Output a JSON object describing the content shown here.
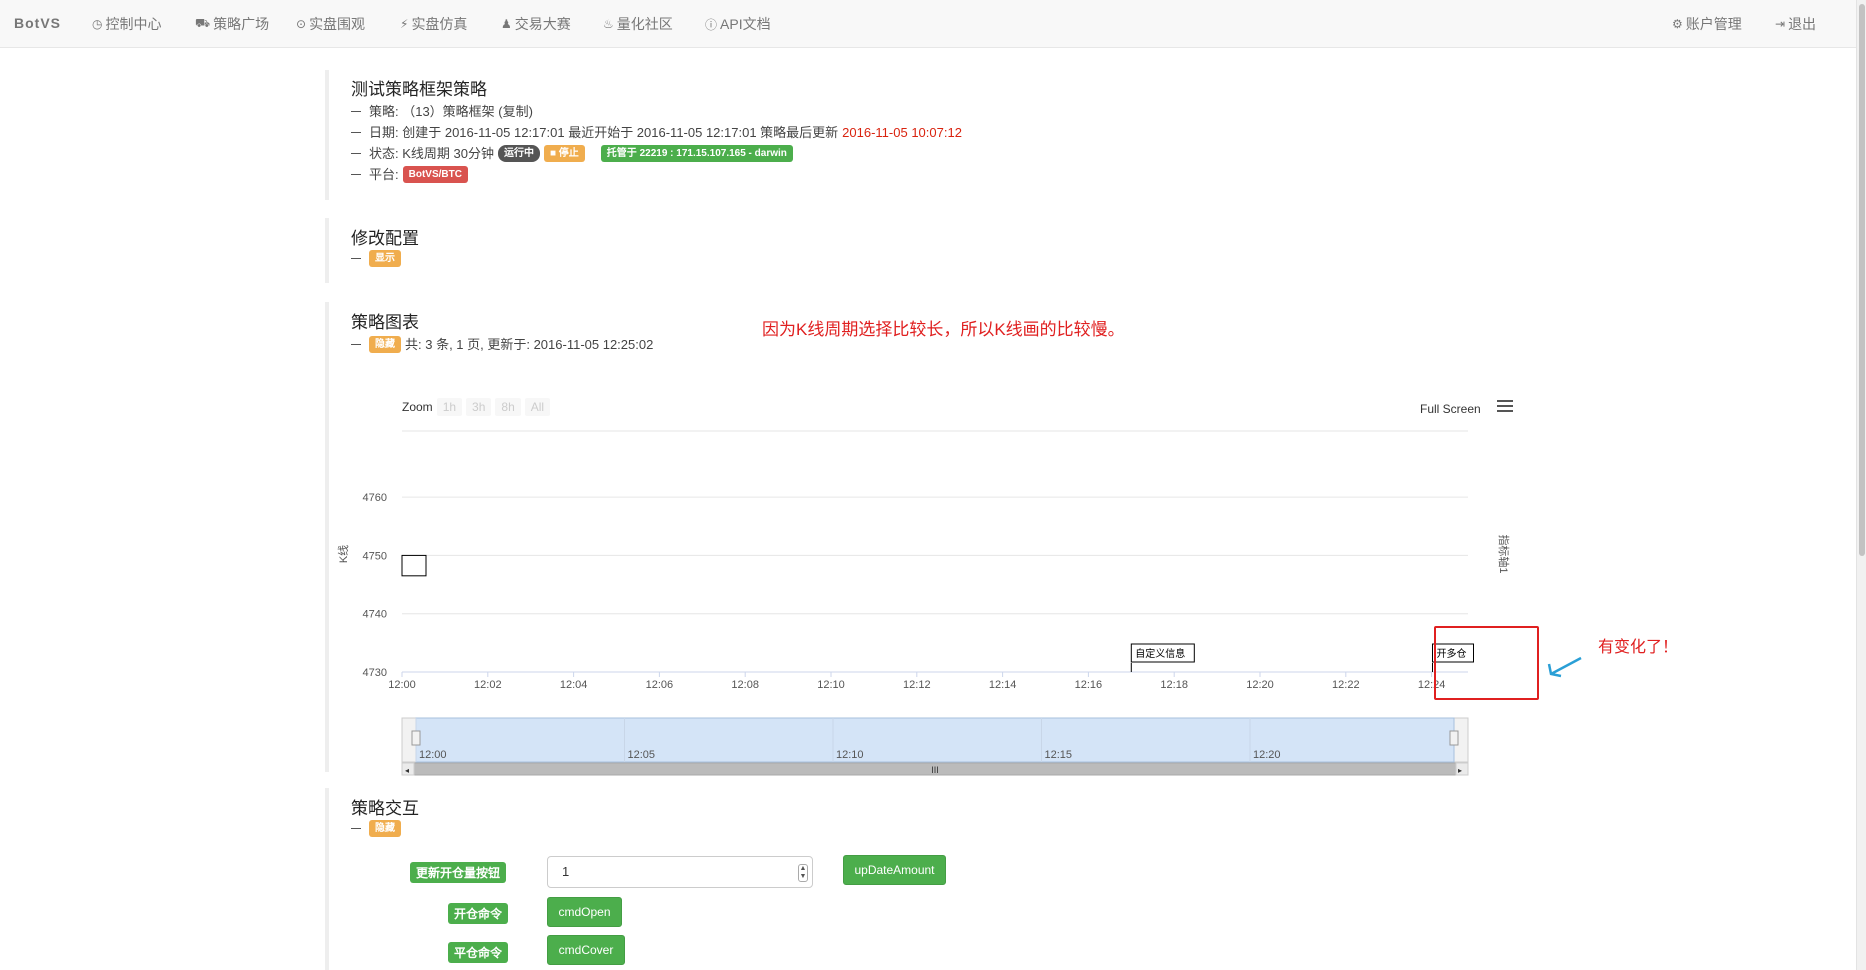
{
  "nav": {
    "brand": "BotVS",
    "items": [
      {
        "label": "控制中心",
        "icon": "clock-icon"
      },
      {
        "label": "策略广场",
        "icon": "cart-icon"
      },
      {
        "label": "实盘围观",
        "icon": "play-circle-icon"
      },
      {
        "label": "实盘仿真",
        "icon": "bolt-icon"
      },
      {
        "label": "交易大赛",
        "icon": "user-icon"
      },
      {
        "label": "量化社区",
        "icon": "fire-icon"
      },
      {
        "label": "API文档",
        "icon": "info-icon"
      }
    ],
    "account": "账户管理",
    "logout": "退出"
  },
  "strategy": {
    "title": "测试策略框架策略",
    "line1": "策略: （13）策略框架 (复制)",
    "date_prefix": "日期: 创建于 2016-11-05 12:17:01 最近开始于 2016-11-05 12:17:01 策略最后更新",
    "date_updated": "2016-11-05 10:07:12",
    "status_prefix": "状态: K线周期 30分钟",
    "status_running": "运行中",
    "status_stop": "停止",
    "host": "托管于 22219 : 171.15.107.165 - darwin",
    "platform_prefix": "平台:",
    "platform": "BotVS/BTC"
  },
  "config": {
    "title": "修改配置",
    "toggle": "显示"
  },
  "chart_section": {
    "title": "策略图表",
    "toggle": "隐藏",
    "summary": "共: 3 条, 1 页, 更新于: 2016-11-05 12:25:02",
    "annotation": "因为K线周期选择比较长，所以K线画的比较慢。"
  },
  "chart_controls": {
    "zoom_label": "Zoom",
    "zoom_options": [
      "1h",
      "3h",
      "8h",
      "All"
    ],
    "fullscreen": "Full Screen"
  },
  "chart_data": {
    "type": "candlestick",
    "ylabel": "K线",
    "ylabel_right": "指标轴1",
    "y_ticks": [
      4730,
      4740,
      4750,
      4760
    ],
    "ylim": [
      4730,
      4771
    ],
    "x_ticks": [
      "12:00",
      "12:02",
      "12:04",
      "12:06",
      "12:08",
      "12:10",
      "12:12",
      "12:14",
      "12:16",
      "12:18",
      "12:20",
      "12:22",
      "12:24"
    ],
    "candles": [
      {
        "time": "12:00",
        "open": 4750,
        "close": 4746.5,
        "high": 4750,
        "low": 4746.5
      }
    ],
    "flags": [
      {
        "time": "12:17",
        "label": "自定义信息"
      },
      {
        "time": "12:25",
        "label": "开多仓"
      }
    ],
    "navigator_ticks": [
      "12:00",
      "12:05",
      "12:10",
      "12:15",
      "12:20"
    ],
    "grid": true
  },
  "annotation2": "有变化了！",
  "interaction": {
    "title": "策略交互",
    "toggle": "隐藏",
    "rows": [
      {
        "label": "更新开仓量按钮",
        "value": "1",
        "button": "upDateAmount"
      },
      {
        "label": "开仓命令",
        "button": "cmdOpen"
      },
      {
        "label": "平仓命令",
        "button": "cmdCover"
      }
    ]
  }
}
